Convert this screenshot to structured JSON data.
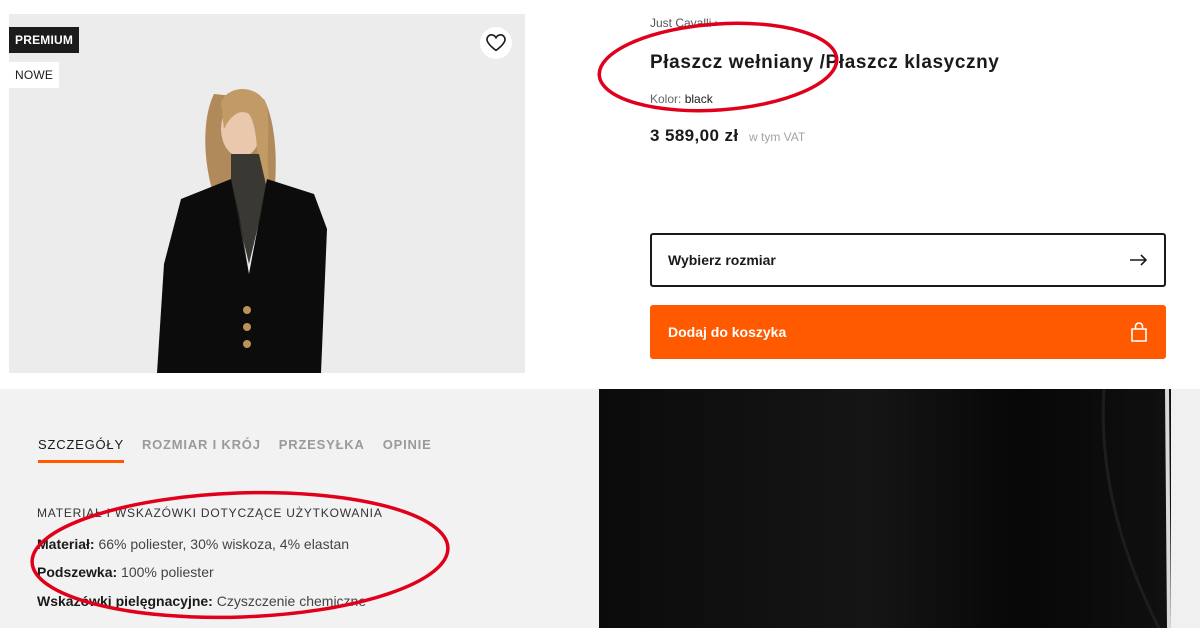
{
  "product_image": {
    "badges": {
      "premium": "PREMIUM",
      "new": "NOWE"
    },
    "wishlist_icon": "heart-outline-icon"
  },
  "product": {
    "brand": "Just Cavalli",
    "title": "Płaszcz wełniany /Płaszcz klasyczny",
    "color_label": "Kolor:",
    "color_value": "black",
    "price": "3 589,00 zł",
    "vat_note": "w tym VAT"
  },
  "actions": {
    "size_label": "Wybierz rozmiar",
    "size_icon": "arrow-right-icon",
    "cart_label": "Dodaj do koszyka",
    "cart_icon": "shopping-bag-icon"
  },
  "details": {
    "tabs": [
      {
        "label": "SZCZEGÓŁY",
        "active": true
      },
      {
        "label": "ROZMIAR I KRÓJ",
        "active": false
      },
      {
        "label": "PRZESYŁKA",
        "active": false
      },
      {
        "label": "OPINIE",
        "active": false
      }
    ],
    "section_title": "MATERIAŁ I WSKAZÓWKI DOTYCZĄCE UŻYTKOWANIA",
    "specs": [
      {
        "label": "Materiał:",
        "value": "66% poliester, 30% wiskoza, 4% elastan"
      },
      {
        "label": "Podszewka:",
        "value": "100% poliester"
      },
      {
        "label": "Wskazówki pielęgnacyjne:",
        "value": "Czyszczenie chemiczne"
      }
    ]
  },
  "colors": {
    "accent": "#ff5a00",
    "annotation": "#e0001b",
    "text": "#1a1a1a"
  }
}
